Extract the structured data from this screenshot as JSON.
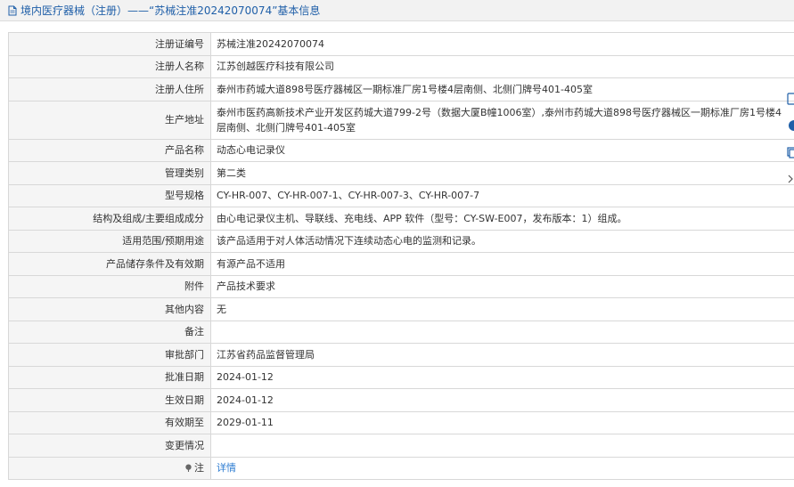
{
  "header": {
    "title": "境内医疗器械（注册）——“苏械注准20242070074”基本信息"
  },
  "rows": [
    {
      "label": "注册证编号",
      "value": "苏械注准20242070074"
    },
    {
      "label": "注册人名称",
      "value": "江苏创越医疗科技有限公司"
    },
    {
      "label": "注册人住所",
      "value": "泰州市药城大道898号医疗器械区一期标准厂房1号楼4层南侧、北侧门牌号401-405室"
    },
    {
      "label": "生产地址",
      "value": "泰州市医药高新技术产业开发区药城大道799-2号（数据大厦B幢1006室）,泰州市药城大道898号医疗器械区一期标准厂房1号楼4层南侧、北侧门牌号401-405室"
    },
    {
      "label": "产品名称",
      "value": "动态心电记录仪"
    },
    {
      "label": "管理类别",
      "value": "第二类"
    },
    {
      "label": "型号规格",
      "value": "CY-HR-007、CY-HR-007-1、CY-HR-007-3、CY-HR-007-7"
    },
    {
      "label": "结构及组成/主要组成成分",
      "value": "由心电记录仪主机、导联线、充电线、APP 软件（型号：CY-SW-E007，发布版本：1）组成。"
    },
    {
      "label": "适用范围/预期用途",
      "value": "该产品适用于对人体活动情况下连续动态心电的监测和记录。"
    },
    {
      "label": "产品储存条件及有效期",
      "value": "有源产品不适用"
    },
    {
      "label": "附件",
      "value": "产品技术要求"
    },
    {
      "label": "其他内容",
      "value": "无"
    },
    {
      "label": "备注",
      "value": ""
    },
    {
      "label": "审批部门",
      "value": "江苏省药品监督管理局"
    },
    {
      "label": "批准日期",
      "value": "2024-01-12"
    },
    {
      "label": "生效日期",
      "value": "2024-01-12"
    },
    {
      "label": "有效期至",
      "value": "2029-01-11"
    },
    {
      "label": "变更情况",
      "value": ""
    }
  ],
  "note": {
    "label": "注",
    "link_text": "详情",
    "link_color": "#2b7bd1"
  },
  "icons": {
    "title": "document-icon",
    "note": "pin-icon",
    "side": [
      "edit-icon",
      "info-icon",
      "copy-icon",
      "chevron-right-icon"
    ]
  },
  "colors": {
    "title_text": "#1f5fa8",
    "label_bg": "#f5f5f5",
    "border": "#d8d8d8"
  }
}
